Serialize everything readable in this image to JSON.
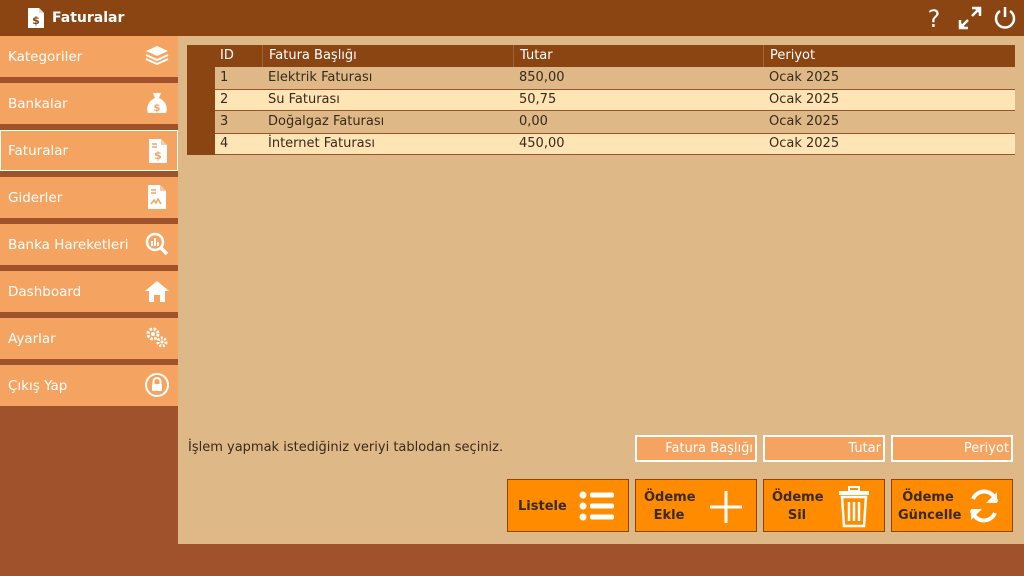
{
  "window": {
    "title": "Faturalar",
    "app_icon": "invoice-icon"
  },
  "title_controls": [
    {
      "name": "help-icon"
    },
    {
      "name": "maximize-icon"
    },
    {
      "name": "power-icon"
    }
  ],
  "sidebar": {
    "items": [
      {
        "label": "Kategoriler",
        "icon": "layers-icon",
        "active": false
      },
      {
        "label": "Bankalar",
        "icon": "money-bag-icon",
        "active": false
      },
      {
        "label": "Faturalar",
        "icon": "invoice-icon",
        "active": true
      },
      {
        "label": "Giderler",
        "icon": "receipt-icon",
        "active": false
      },
      {
        "label": "Banka Hareketleri",
        "icon": "chart-search-icon",
        "active": false
      },
      {
        "label": "Dashboard",
        "icon": "home-icon",
        "active": false
      },
      {
        "label": "Ayarlar",
        "icon": "gears-icon",
        "active": false
      },
      {
        "label": "Çıkış Yap",
        "icon": "lock-icon",
        "active": false
      }
    ]
  },
  "table": {
    "columns": [
      "ID",
      "Fatura Başlığı",
      "Tutar",
      "Periyot"
    ],
    "rows": [
      [
        "1",
        "Elektrik Faturası",
        "850,00",
        "Ocak 2025"
      ],
      [
        "2",
        "Su Faturası",
        "50,75",
        "Ocak 2025"
      ],
      [
        "3",
        "Doğalgaz Faturası",
        "0,00",
        "Ocak 2025"
      ],
      [
        "4",
        "İnternet Faturası",
        "450,00",
        "Ocak 2025"
      ]
    ]
  },
  "hint": "İşlem yapmak istediğiniz veriyi tablodan seçiniz.",
  "inputs": {
    "title_placeholder": "Fatura Başlığı",
    "amount_placeholder": "Tutar",
    "period_placeholder": "Periyot"
  },
  "buttons": {
    "list": {
      "label": "Listele",
      "icon": "list-icon"
    },
    "add": {
      "line1": "Ödeme",
      "line2": "Ekle",
      "icon": "plus-icon"
    },
    "delete": {
      "line1": "Ödeme",
      "line2": "Sil",
      "icon": "trash-icon"
    },
    "update": {
      "line1": "Ödeme",
      "line2": "Güncelle",
      "icon": "refresh-icon"
    }
  },
  "colors": {
    "titlebar": "#8b4513",
    "sidebar_bg": "#a0522d",
    "nav_item": "#f4a460",
    "content_bg": "#deb887",
    "row_alt": "#ffe4b5",
    "button": "#ff8c00"
  }
}
